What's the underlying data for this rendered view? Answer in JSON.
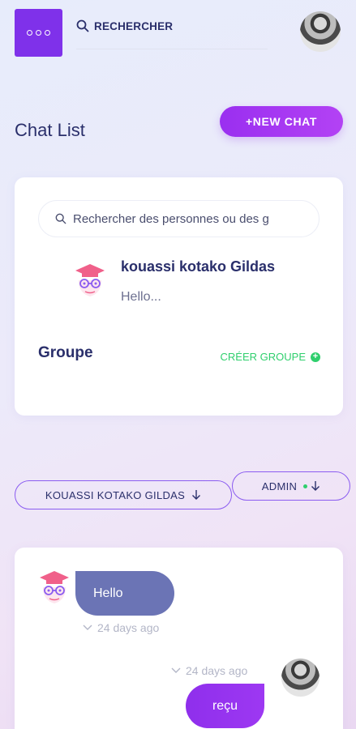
{
  "header": {
    "search_label": "RECHERCHER",
    "menu_icon": "more-dots-icon",
    "avatar_icon": "user-photo-avatar"
  },
  "page": {
    "title": "Chat List",
    "new_chat_label": "+NEW CHAT"
  },
  "contacts": {
    "search_placeholder": "Rechercher des personnes ou des g",
    "items": [
      {
        "name": "kouassi kotako Gildas",
        "last_message": "Hello...",
        "avatar_icon": "graduate-avatar-icon"
      }
    ],
    "group_title": "Groupe",
    "create_group_label": "CRÉER GROUPE"
  },
  "filters": {
    "user_label": "KOUASSI KOTAKO GILDAS",
    "admin_label": "ADMIN"
  },
  "conversation": {
    "messages": [
      {
        "direction": "incoming",
        "text": "Hello",
        "time": "24 days ago"
      },
      {
        "direction": "outgoing",
        "text": "reçu",
        "time": "24 days ago"
      }
    ]
  },
  "colors": {
    "accent": "#7f31ea",
    "text_primary": "#2a2f6b",
    "online": "#2fcf6d",
    "incoming_bubble": "#6b74b5"
  }
}
